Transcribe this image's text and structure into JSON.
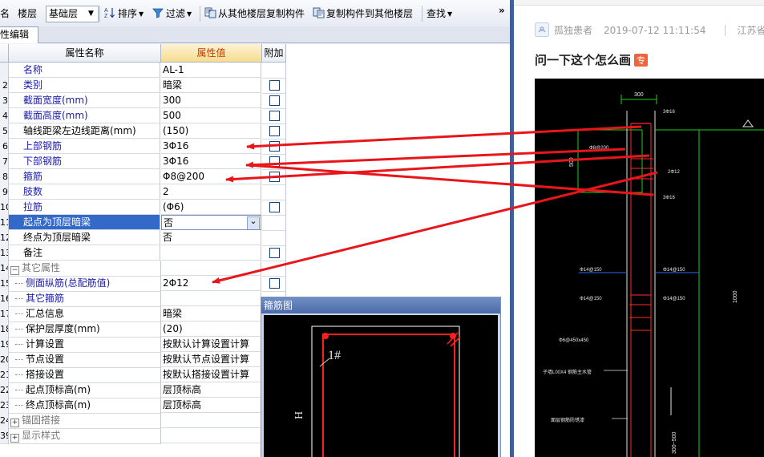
{
  "toolbar": {
    "name_label": "名",
    "floor_label": "楼层",
    "floor_value": "基础层",
    "sort_label": "排序",
    "filter_label": "过滤",
    "copy_from_label": "从其他楼层复制构件",
    "copy_to_label": "复制构件到其他楼层",
    "find_label": "查找",
    "more": "»"
  },
  "tab": {
    "label": "性编辑"
  },
  "grid": {
    "headers": {
      "name": "属性名称",
      "value": "属性值",
      "add": "附加"
    },
    "rows": [
      {
        "num": "",
        "name": "名称",
        "value": "AL-1",
        "check": false,
        "style": "blue"
      },
      {
        "num": "2",
        "name": "类别",
        "value": "暗梁",
        "check": true,
        "style": "blue"
      },
      {
        "num": "3",
        "name": "截面宽度(mm)",
        "value": "300",
        "check": true,
        "style": "blue"
      },
      {
        "num": "4",
        "name": "截面高度(mm)",
        "value": "500",
        "check": true,
        "style": "blue"
      },
      {
        "num": "5",
        "name": "轴线距梁左边线距离(mm)",
        "value": "(150)",
        "check": true,
        "style": "normal"
      },
      {
        "num": "6",
        "name": "上部钢筋",
        "value": "3Φ16",
        "check": true,
        "style": "blue"
      },
      {
        "num": "7",
        "name": "下部钢筋",
        "value": "3Φ16",
        "check": true,
        "style": "blue"
      },
      {
        "num": "8",
        "name": "箍筋",
        "value": "Φ8@200",
        "check": true,
        "style": "blue"
      },
      {
        "num": "9",
        "name": "肢数",
        "value": "2",
        "check": false,
        "style": "blue"
      },
      {
        "num": "10",
        "name": "拉筋",
        "value": "(Φ6)",
        "check": true,
        "style": "blue"
      },
      {
        "num": "11",
        "name": "起点为顶层暗梁",
        "value": "否",
        "check": false,
        "style": "selected"
      },
      {
        "num": "12",
        "name": "终点为顶层暗梁",
        "value": "否",
        "check": false,
        "style": "normal"
      },
      {
        "num": "13",
        "name": "备注",
        "value": "",
        "check": true,
        "style": "normal"
      },
      {
        "num": "14",
        "name": "其它属性",
        "value": "",
        "check": false,
        "style": "group"
      },
      {
        "num": "15",
        "name": "侧面纵筋(总配筋值)",
        "value": "2Φ12",
        "check": true,
        "style": "blue-child"
      },
      {
        "num": "16",
        "name": "其它箍筋",
        "value": "",
        "check": false,
        "style": "blue-child"
      },
      {
        "num": "17",
        "name": "汇总信息",
        "value": "暗梁",
        "check": false,
        "style": "child"
      },
      {
        "num": "18",
        "name": "保护层厚度(mm)",
        "value": "(20)",
        "check": false,
        "style": "child"
      },
      {
        "num": "19",
        "name": "计算设置",
        "value": "按默认计算设置计算",
        "check": false,
        "style": "child"
      },
      {
        "num": "20",
        "name": "节点设置",
        "value": "按默认节点设置计算",
        "check": false,
        "style": "child"
      },
      {
        "num": "21",
        "name": "搭接设置",
        "value": "按默认搭接设置计算",
        "check": false,
        "style": "child"
      },
      {
        "num": "22",
        "name": "起点顶标高(m)",
        "value": "层顶标高",
        "check": false,
        "style": "child"
      },
      {
        "num": "23",
        "name": "终点顶标高(m)",
        "value": "层顶标高",
        "check": false,
        "style": "child"
      },
      {
        "num": "24",
        "name": "锚固搭接",
        "value": "",
        "check": false,
        "style": "group-collapsed"
      },
      {
        "num": "39",
        "name": "显示样式",
        "value": "",
        "check": false,
        "style": "group-collapsed"
      }
    ]
  },
  "stirrup_window": {
    "title": "箍筋图",
    "bar_label": "1#",
    "side_label": "H"
  },
  "post": {
    "author": "孤独患者",
    "datetime": "2019-07-12 11:11:54",
    "location": "江苏省",
    "title": "问一下这个怎么画",
    "badge": "专"
  },
  "cad": {
    "dim_width": "300",
    "dim_height_top": "500",
    "dim_height_right": "1000",
    "dim_bottom": "300~500",
    "top_bar": "3Φ16",
    "bottom_bar": "3Φ16",
    "stirrup": "Φ8@200",
    "side_bar": "2Φ12",
    "wall_left_1": "Φ14@150",
    "wall_right_1": "Φ14@150",
    "wall_left_2": "Φ14@150",
    "wall_right_2": "Φ14@150",
    "tie": "Φ6@450x450",
    "note_1": "子墙L00X4 钢筋主水管",
    "note_2": "面层钢筋防锈漆"
  },
  "colors": {
    "arrow": "#e8161b",
    "cad_bg": "#000000",
    "cad_green": "#19d219",
    "cad_red": "#ff2a2a",
    "selection": "#3369c9"
  },
  "icons": [
    "sort-icon",
    "filter-icon",
    "copy-from-icon",
    "copy-to-icon",
    "dropdown-icon",
    "checkbox-icon",
    "expander-icon"
  ]
}
